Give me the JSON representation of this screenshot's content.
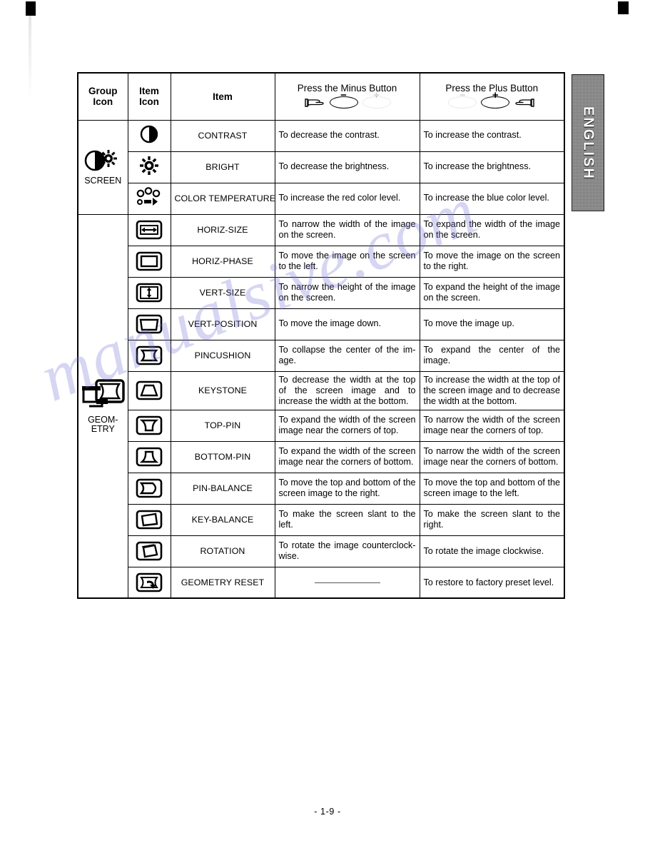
{
  "page": {
    "footer": "- 1-9 -",
    "language_tab": "ENGLISH",
    "watermark": "manualsive.com"
  },
  "table": {
    "headers": {
      "group_icon": "Group\nIcon",
      "group_icon_line1": "Group",
      "group_icon_line2": "Icon",
      "item_icon_line1": "Item",
      "item_icon_line2": "Icon",
      "item": "Item",
      "minus_button": "Press the Minus Button",
      "plus_button": "Press the Plus Button",
      "minus_sign": "−",
      "plus_sign": "+"
    },
    "groups": [
      {
        "name": "SCREEN",
        "icon": "screen-contrast-sun-icon",
        "rows": [
          {
            "item": "CONTRAST",
            "icon": "contrast-half-circle-icon",
            "minus": "To decrease the contrast.",
            "plus": "To increase the contrast."
          },
          {
            "item": "BRIGHT",
            "icon": "brightness-sun-icon",
            "minus": "To decrease the brightness.",
            "plus": "To increase the brightness."
          },
          {
            "item": "COLOR TEMPERATURE",
            "icon": "color-temperature-icon",
            "minus": "To increase the red color level.",
            "plus": "To increase the blue color level."
          }
        ]
      },
      {
        "name_line1": "GEOM-",
        "name_line2": "ETRY",
        "name": "GEOMETRY",
        "icon": "geometry-monitor-icon",
        "rows": [
          {
            "item": "HORIZ-SIZE",
            "icon": "horiz-size-icon",
            "minus": "To narrow the width of the image on the screen.",
            "plus": "To expand the width of the image on the screen."
          },
          {
            "item": "HORIZ-PHASE",
            "icon": "horiz-phase-icon",
            "minus": "To move the image on the screen to the left.",
            "plus": "To move the image on the screen to the right."
          },
          {
            "item": "VERT-SIZE",
            "icon": "vert-size-icon",
            "minus": "To narrow the height of the image on the screen.",
            "plus": "To expand the height of the image on the screen."
          },
          {
            "item": "VERT-POSITION",
            "icon": "vert-position-icon",
            "minus": "To move the image down.",
            "plus": "To move the image up."
          },
          {
            "item": "PINCUSHION",
            "icon": "pincushion-icon",
            "minus": "To collapse the center of the im-age.",
            "plus": "To expand the center of the image."
          },
          {
            "item": "KEYSTONE",
            "icon": "keystone-icon",
            "minus": "To decrease the width at the top of the screen image and to increase the width at the bottom.",
            "plus": "To increase the width at the top of the screen image and to decrease the width at the bottom."
          },
          {
            "item": "TOP-PIN",
            "icon": "top-pin-icon",
            "minus": "To expand the width of the screen image near the corners of top.",
            "plus": "To narrow the width of the screen image near the corners of top."
          },
          {
            "item": "BOTTOM-PIN",
            "icon": "bottom-pin-icon",
            "minus": "To expand the width of the screen image near the corners of bottom.",
            "plus": "To narrow the width of the screen image near the corners of bottom."
          },
          {
            "item": "PIN-BALANCE",
            "icon": "pin-balance-icon",
            "minus": "To move the top and bottom of the screen image to the right.",
            "plus": "To move the top and bottom of the screen image to the left."
          },
          {
            "item": "KEY-BALANCE",
            "icon": "key-balance-icon",
            "minus": "To make the screen slant to the left.",
            "plus": "To make the screen slant to the right."
          },
          {
            "item": "ROTATION",
            "icon": "rotation-icon",
            "minus": "To rotate the image counterclock-wise.",
            "plus": "To rotate the image clockwise."
          },
          {
            "item": "GEOMETRY RESET",
            "icon": "geometry-reset-icon",
            "minus": "",
            "minus_is_dash": true,
            "plus": "To restore to factory preset level."
          }
        ]
      }
    ]
  }
}
